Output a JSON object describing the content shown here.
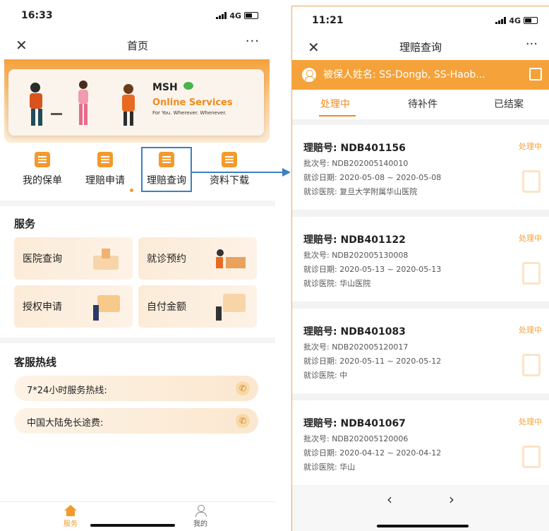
{
  "left": {
    "status_time": "16:33",
    "network": "4G",
    "title": "首页",
    "close_glyph": "✕",
    "more_glyph": "···",
    "banner": {
      "brand": "MSH",
      "subtitle": "Online Services",
      "tagline": "For You. Wherever. Whenever."
    },
    "quick_actions": [
      {
        "label": "我的保单",
        "icon": "policy-icon"
      },
      {
        "label": "理赔申请",
        "icon": "claim-apply-icon"
      },
      {
        "label": "理赔查询",
        "icon": "claim-search-icon"
      },
      {
        "label": "资料下载",
        "icon": "download-icon"
      }
    ],
    "services_title": "服务",
    "services": [
      {
        "label": "医院查询"
      },
      {
        "label": "就诊预约"
      },
      {
        "label": "授权申请"
      },
      {
        "label": "自付金额"
      }
    ],
    "hotline_title": "客服热线",
    "hotlines": [
      {
        "label": "7*24小时服务热线:"
      },
      {
        "label": "中国大陆免长途费:"
      }
    ],
    "tabbar": {
      "home": "服务",
      "mine": "我的"
    }
  },
  "right": {
    "status_time": "11:21",
    "network": "4G",
    "title": "理赔查询",
    "close_glyph": "✕",
    "more_glyph": "···",
    "insured_label": "被保人姓名: SS-Dongb, SS-Haob...",
    "tabs": [
      {
        "label": "处理中",
        "active": true
      },
      {
        "label": "待补件",
        "active": false
      },
      {
        "label": "已结案",
        "active": false
      }
    ],
    "claims": [
      {
        "no": "理赔号: NDB401156",
        "batch": "批次号: NDB202005140010",
        "date": "就诊日期: 2020-05-08 ~ 2020-05-08",
        "hospital": "就诊医院: 复旦大学附属华山医院",
        "status": "处理中"
      },
      {
        "no": "理赔号: NDB401122",
        "batch": "批次号: NDB202005130008",
        "date": "就诊日期: 2020-05-13 ~ 2020-05-13",
        "hospital": "就诊医院: 华山医院",
        "status": "处理中"
      },
      {
        "no": "理赔号: NDB401083",
        "batch": "批次号: NDB202005120017",
        "date": "就诊日期: 2020-05-11 ~ 2020-05-12",
        "hospital": "就诊医院: 中",
        "status": "处理中"
      },
      {
        "no": "理赔号: NDB401067",
        "batch": "批次号: NDB202005120006",
        "date": "就诊日期: 2020-04-12 ~ 2020-04-12",
        "hospital": "就诊医院: 华山",
        "status": "处理中"
      }
    ],
    "pager": {
      "prev": "‹",
      "next": "›"
    }
  },
  "colors": {
    "accent": "#f39a2b",
    "highlight_box": "#3d7fc2",
    "status_orange": "#f5a23a"
  }
}
